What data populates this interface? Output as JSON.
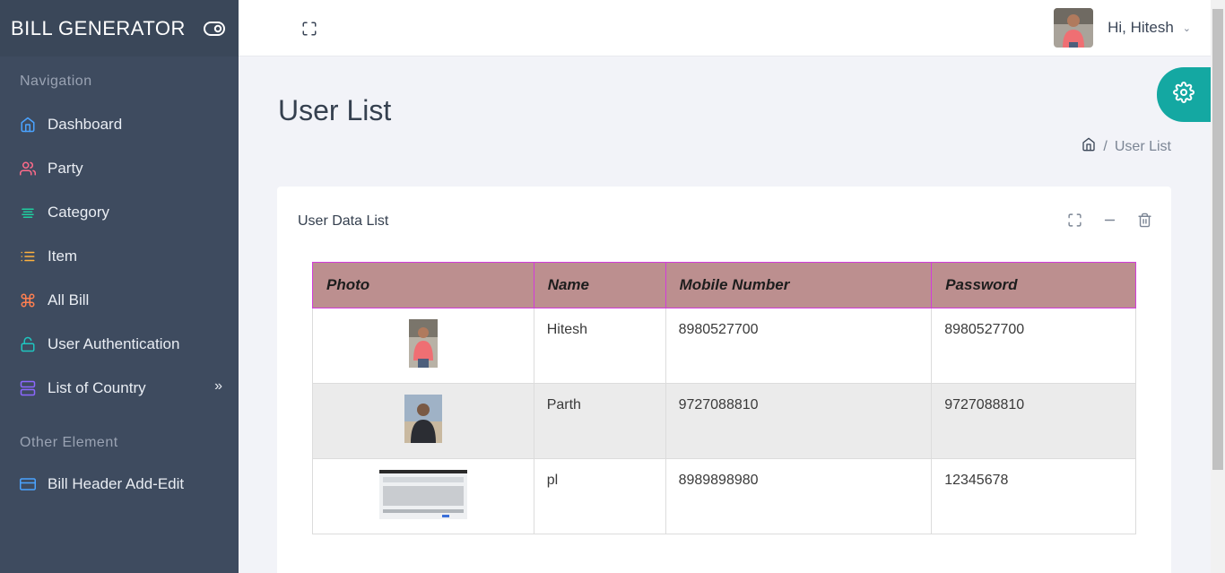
{
  "app": {
    "brand": "BILL GENERATOR"
  },
  "sidebar": {
    "sections": [
      {
        "title": "Navigation"
      },
      {
        "title": "Other Element"
      }
    ],
    "items": [
      {
        "label": "Dashboard",
        "icon": "home-icon",
        "color": "#4aa3ff"
      },
      {
        "label": "Party",
        "icon": "users-icon",
        "color": "#ff6b8a"
      },
      {
        "label": "Category",
        "icon": "align-icon",
        "color": "#1fcf9f"
      },
      {
        "label": "Item",
        "icon": "list-icon",
        "color": "#ffb23e"
      },
      {
        "label": "All Bill",
        "icon": "command-icon",
        "color": "#ff7f50"
      },
      {
        "label": "User Authentication",
        "icon": "unlock-icon",
        "color": "#1fc6c0"
      },
      {
        "label": "List of Country",
        "icon": "server-icon",
        "color": "#8c67ff"
      },
      {
        "label": "Bill Header Add-Edit",
        "icon": "credit-card-icon",
        "color": "#4aa3ff"
      }
    ]
  },
  "header": {
    "greeting": "Hi, Hitesh"
  },
  "page": {
    "title": "User List",
    "breadcrumb": [
      "User List"
    ]
  },
  "card": {
    "title": "User Data List",
    "columns": [
      "Photo",
      "Name",
      "Mobile Number",
      "Password"
    ],
    "rows": [
      {
        "name": "Hitesh",
        "mobile": "8980527700",
        "password": "8980527700"
      },
      {
        "name": "Parth",
        "mobile": "9727088810",
        "password": "9727088810"
      },
      {
        "name": "pl",
        "mobile": "8989898980",
        "password": "12345678"
      }
    ]
  },
  "colors": {
    "sidebar": "#3e4b5f",
    "accent": "#14a8a2",
    "table_header": "#bc8f8f",
    "table_header_border": "#d23cdb"
  }
}
